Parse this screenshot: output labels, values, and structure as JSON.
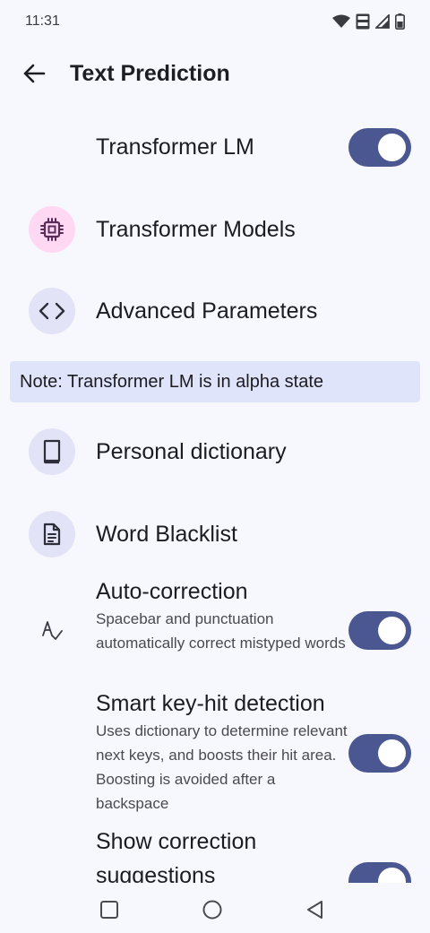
{
  "status_bar": {
    "time": "11:31",
    "icons": [
      "wifi-icon",
      "volte-icon",
      "signal-icon",
      "battery-icon"
    ]
  },
  "app_bar": {
    "back_icon": "arrow-left-icon",
    "title": "Text Prediction"
  },
  "settings": {
    "transformer_lm": {
      "label": "Transformer LM",
      "enabled": true
    },
    "transformer_models": {
      "label": "Transformer Models",
      "icon": "chip-icon"
    },
    "advanced_parameters": {
      "label": "Advanced Parameters",
      "icon": "code-icon"
    },
    "note": "Note: Transformer LM is in alpha state",
    "personal_dictionary": {
      "label": "Personal dictionary",
      "icon": "book-icon"
    },
    "word_blacklist": {
      "label": "Word Blacklist",
      "icon": "document-icon"
    },
    "auto_correction": {
      "title": "Auto-correction",
      "description": "Spacebar and punctuation automatically correct mistyped words",
      "icon": "spellcheck-icon",
      "enabled": true
    },
    "smart_key_hit": {
      "title": "Smart key-hit detection",
      "description": "Uses dictionary to determine relevant next keys, and boosts their hit area. Boosting is avoided after a backspace",
      "enabled": true
    },
    "show_correction": {
      "title": "Show correction suggestions",
      "enabled": true
    }
  },
  "colors": {
    "background": "#f7f8fd",
    "toggle_on": "#4b5791",
    "note_background": "#dfe4fb",
    "icon_circle": "#e2e3f6",
    "icon_circle_pink": "#ffd8f4"
  },
  "nav_bar": {
    "icons": [
      "recents-square-icon",
      "home-circle-icon",
      "back-triangle-icon"
    ]
  }
}
